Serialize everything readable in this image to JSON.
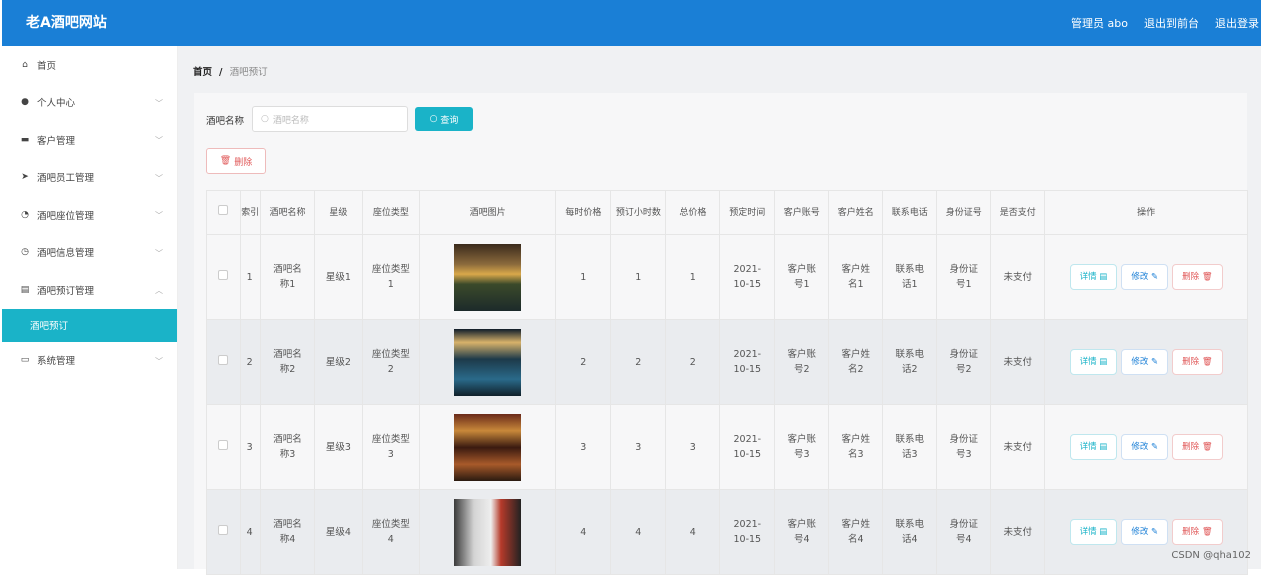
{
  "header": {
    "title": "老A酒吧网站",
    "admin": "管理员 abo",
    "front": "退出到前台",
    "logout": "退出登录"
  },
  "sidebar": {
    "items": [
      {
        "label": "首页",
        "icon": "home-icon",
        "glyph": "⌂",
        "chev": false
      },
      {
        "label": "个人中心",
        "icon": "user-icon",
        "glyph": "●",
        "chev": true
      },
      {
        "label": "客户管理",
        "icon": "monitor-icon",
        "glyph": "▬",
        "chev": true
      },
      {
        "label": "酒吧员工管理",
        "icon": "send-icon",
        "glyph": "➤",
        "chev": true
      },
      {
        "label": "酒吧座位管理",
        "icon": "speed-icon",
        "glyph": "◔",
        "chev": true
      },
      {
        "label": "酒吧信息管理",
        "icon": "clock-icon",
        "glyph": "◷",
        "chev": true
      },
      {
        "label": "酒吧预订管理",
        "icon": "briefcase-icon",
        "glyph": "▤",
        "chev": true,
        "open": true
      }
    ],
    "sub": "酒吧预订",
    "last": {
      "label": "系统管理",
      "icon": "chat-icon",
      "glyph": "▭"
    }
  },
  "breadcrumb": {
    "home": "首页",
    "sep": "/",
    "current": "酒吧预订"
  },
  "search": {
    "label": "酒吧名称",
    "placeholder": "酒吧名称",
    "query_btn": "查询",
    "delete_btn": "删除"
  },
  "table": {
    "headers": [
      "索引",
      "酒吧名称",
      "星级",
      "座位类型",
      "酒吧图片",
      "每时价格",
      "预订小时数",
      "总价格",
      "预定时间",
      "客户账号",
      "客户姓名",
      "联系电话",
      "身份证号",
      "是否支付",
      "操作"
    ],
    "rows": [
      {
        "idx": "1",
        "name": "酒吧名称1",
        "star": "星级1",
        "seat": "座位类型1",
        "price": "1",
        "hours": "1",
        "total": "1",
        "time": "2021-10-15",
        "acct": "客户账号1",
        "cname": "客户姓名1",
        "phone": "联系电话1",
        "id": "身份证号1",
        "paid": "未支付"
      },
      {
        "idx": "2",
        "name": "酒吧名称2",
        "star": "星级2",
        "seat": "座位类型2",
        "price": "2",
        "hours": "2",
        "total": "2",
        "time": "2021-10-15",
        "acct": "客户账号2",
        "cname": "客户姓名2",
        "phone": "联系电话2",
        "id": "身份证号2",
        "paid": "未支付"
      },
      {
        "idx": "3",
        "name": "酒吧名称3",
        "star": "星级3",
        "seat": "座位类型3",
        "price": "3",
        "hours": "3",
        "total": "3",
        "time": "2021-10-15",
        "acct": "客户账号3",
        "cname": "客户姓名3",
        "phone": "联系电话3",
        "id": "身份证号3",
        "paid": "未支付"
      },
      {
        "idx": "4",
        "name": "酒吧名称4",
        "star": "星级4",
        "seat": "座位类型4",
        "price": "4",
        "hours": "4",
        "total": "4",
        "time": "2021-10-15",
        "acct": "客户账号4",
        "cname": "客户姓名4",
        "phone": "联系电话4",
        "id": "身份证号4",
        "paid": "未支付"
      }
    ],
    "ops": {
      "detail": "详情",
      "edit": "修改",
      "delete": "删除"
    }
  },
  "watermark": "CSDN @qha102"
}
